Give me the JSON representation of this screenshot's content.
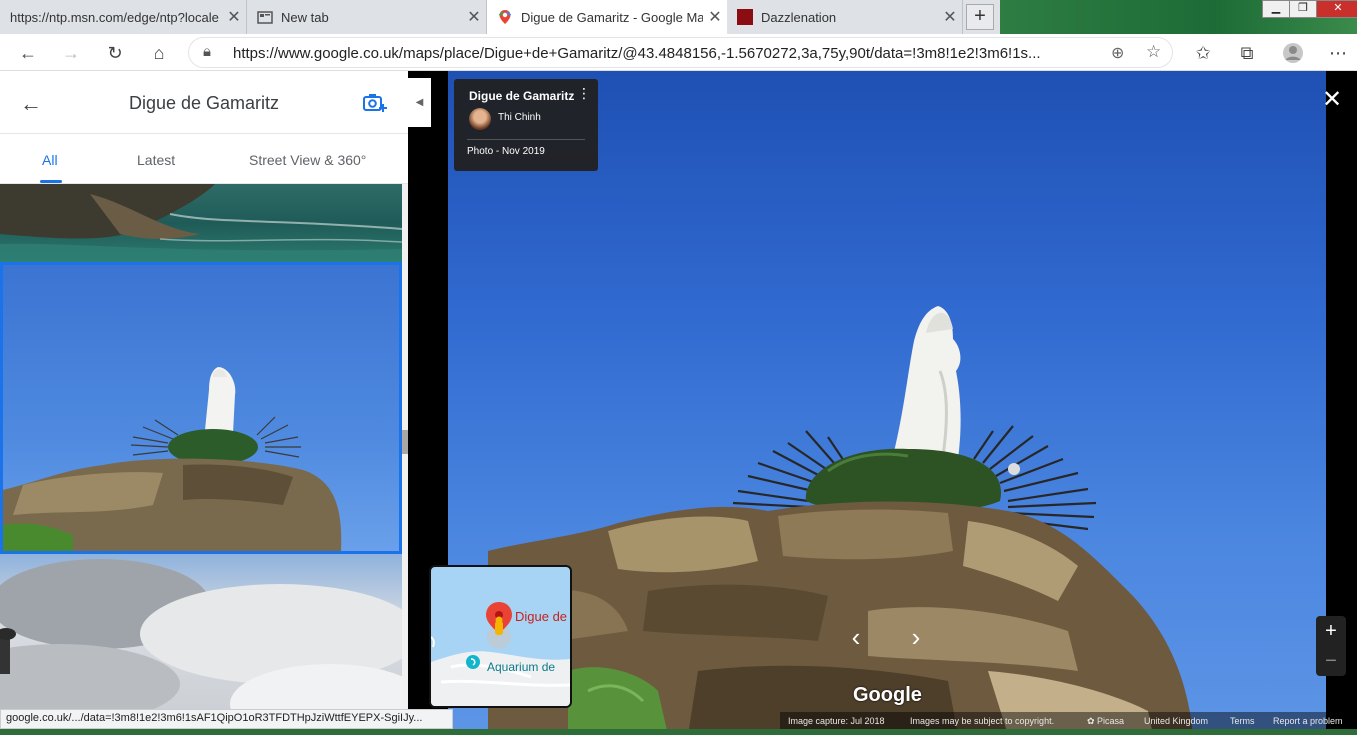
{
  "browser": {
    "tabs": [
      {
        "label": "https://ntp.msn.com/edge/ntp?locale",
        "active": false
      },
      {
        "label": "New tab",
        "active": false
      },
      {
        "label": "Digue de Gamaritz - Google Maps",
        "active": true
      },
      {
        "label": "Dazzlenation",
        "active": false
      }
    ],
    "new_tab_symbol": "+",
    "close_symbol": "✕",
    "url": "https://www.google.co.uk/maps/place/Digue+de+Gamaritz/@43.4848156,-1.5670272,3a,75y,90t/data=!3m8!1e2!3m6!1s..."
  },
  "side_panel": {
    "title": "Digue de Gamaritz",
    "tabs": [
      {
        "label": "All",
        "active": true
      },
      {
        "label": "Latest",
        "active": false
      },
      {
        "label": "Street View & 360°",
        "active": false
      }
    ]
  },
  "photo_info": {
    "place": "Digue de Gamaritz",
    "author": "Thi Chinh",
    "date": "Photo - Nov 2019"
  },
  "minimap": {
    "pin_label": "Digue de",
    "poi_label": "Aquarium de"
  },
  "viewer": {
    "logo": "Google",
    "close_symbol": "✕",
    "zoom_in": "+",
    "zoom_out": "−",
    "prev": "‹",
    "next": "›"
  },
  "footer": {
    "capture": "Image capture: Jul 2018",
    "copyright": "Images may be subject to copyright.",
    "picasa": "Picasa",
    "region": "United Kingdom",
    "terms": "Terms",
    "report": "Report a problem"
  },
  "status_url": "google.co.uk/.../data=!3m8!1e2!3m6!1sAF1QipO1oR3TFDTHpJziWttfEYEPX-SgiIJy...",
  "colors": {
    "accent": "#1a73e8",
    "sky": "#3069cf",
    "pin": "#ea4335"
  }
}
